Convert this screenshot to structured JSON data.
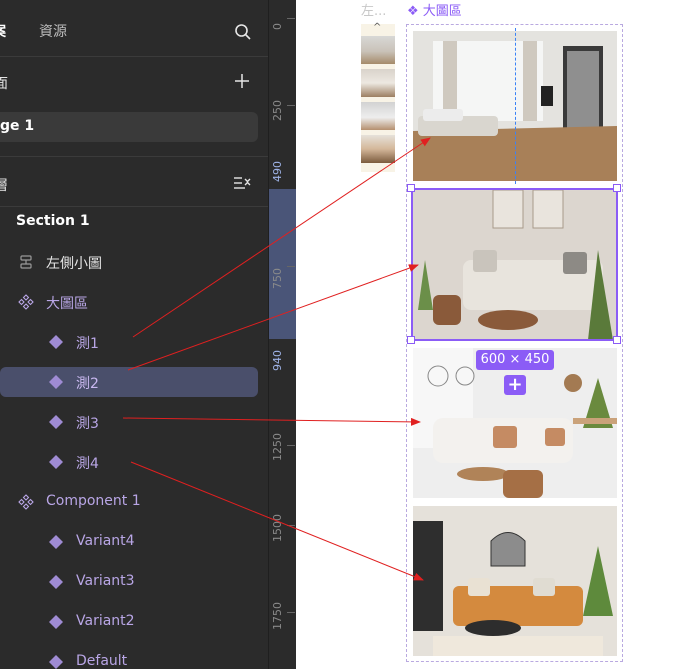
{
  "tabs": {
    "active": "案",
    "inactive": "資源"
  },
  "pages": {
    "title": "面",
    "item": "ge 1"
  },
  "layers": {
    "title": "層",
    "items": [
      {
        "label": "Section 1",
        "type": "section"
      },
      {
        "label": "左側小圖",
        "type": "frame"
      },
      {
        "label": "大圖區",
        "type": "component"
      },
      {
        "label": "測1",
        "type": "instance"
      },
      {
        "label": "測2",
        "type": "instance",
        "selected": true
      },
      {
        "label": "測3",
        "type": "instance"
      },
      {
        "label": "測4",
        "type": "instance"
      },
      {
        "label": "Component 1",
        "type": "component"
      },
      {
        "label": "Variant4",
        "type": "instance"
      },
      {
        "label": "Variant3",
        "type": "instance"
      },
      {
        "label": "Variant2",
        "type": "instance"
      },
      {
        "label": "Default",
        "type": "instance"
      }
    ]
  },
  "ruler": {
    "labels": [
      "0",
      "250",
      "490",
      "750",
      "940",
      "1250",
      "1500",
      "1750"
    ],
    "highlighted": [
      "490",
      "750",
      "940"
    ]
  },
  "canvas": {
    "left_frame_label": "左...",
    "main_frame_label": "大圖區",
    "size_badge": "600 × 450",
    "plus_badge": "+"
  },
  "colors": {
    "accent": "#8b5cf6",
    "layer_text": "#b9a6e6",
    "arrow": "#e02020"
  }
}
